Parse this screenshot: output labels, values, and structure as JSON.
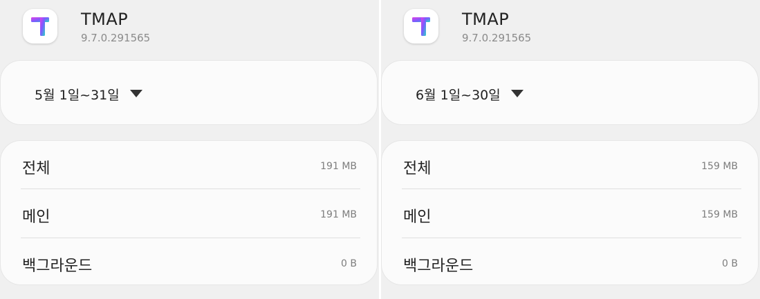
{
  "panels": [
    {
      "app": {
        "name": "TMAP",
        "version": "9.7.0.291565"
      },
      "date_range": {
        "label": "5월 1일~31일"
      },
      "usage": [
        {
          "label": "전체",
          "value": "191 MB"
        },
        {
          "label": "메인",
          "value": "191 MB"
        },
        {
          "label": "백그라운드",
          "value": "0 B"
        }
      ]
    },
    {
      "app": {
        "name": "TMAP",
        "version": "9.7.0.291565"
      },
      "date_range": {
        "label": "6월 1일~30일"
      },
      "usage": [
        {
          "label": "전체",
          "value": "159 MB"
        },
        {
          "label": "메인",
          "value": "159 MB"
        },
        {
          "label": "백그라운드",
          "value": "0 B"
        }
      ]
    }
  ],
  "colors": {
    "background": "#f0f0f0",
    "card": "#fbfbfb",
    "logo_gradient": [
      "#e040e8",
      "#7a5cff",
      "#2bd3c7"
    ]
  },
  "icons": {
    "app_logo": "tmap-logo-icon",
    "dropdown": "caret-down-icon"
  }
}
